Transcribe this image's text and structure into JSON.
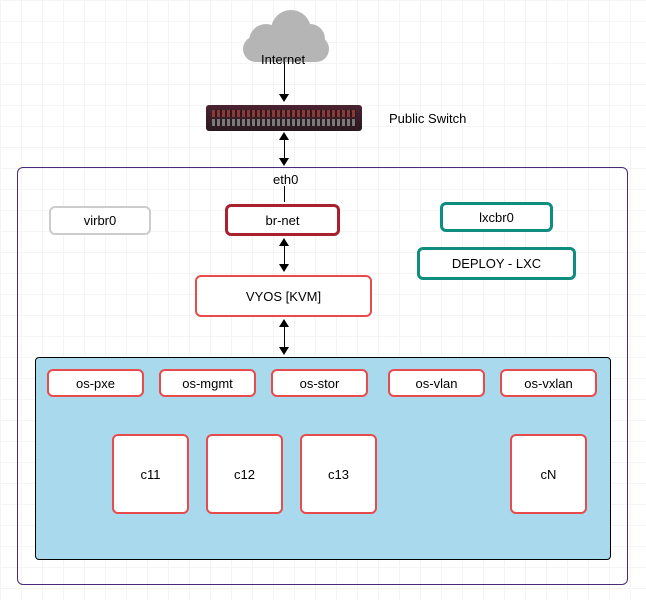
{
  "labels": {
    "internet": "Internet",
    "public_switch": "Public Switch",
    "eth0": "eth0"
  },
  "boxes": {
    "virbr0": "virbr0",
    "brnet": "br-net",
    "lxcbr0": "lxcbr0",
    "deploy_lxc": "DEPLOY - LXC",
    "vyos": "VYOS [KVM]"
  },
  "bridges": {
    "ospxe": "os-pxe",
    "osmgmt": "os-mgmt",
    "osstor": "os-stor",
    "osvlan": "os-vlan",
    "osvxlan": "os-vxlan"
  },
  "containers": {
    "c11": "c11",
    "c12": "c12",
    "c13": "c13",
    "cN": "cN"
  }
}
